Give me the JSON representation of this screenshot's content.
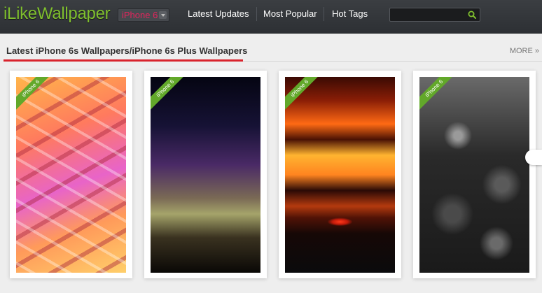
{
  "header": {
    "logo": "iLikeWallpaper",
    "device_select": "iPhone 6",
    "nav": [
      "Latest Updates",
      "Most Popular",
      "Hot Tags"
    ],
    "search": {
      "value": "",
      "placeholder": ""
    }
  },
  "section": {
    "title": "Latest iPhone 6s Wallpapers/iPhone 6s Plus Wallpapers",
    "more": "MORE »"
  },
  "wallpapers": [
    {
      "badge": "iPhone 6",
      "subject": "colorful ribbons"
    },
    {
      "badge": "iPhone 6",
      "subject": "purple green gradient"
    },
    {
      "badge": "iPhone 6",
      "subject": "red sunset"
    },
    {
      "badge": "iPhone 6",
      "subject": "black and white roses"
    }
  ],
  "colors": {
    "logo": "#7fbf2e",
    "device": "#e2255c",
    "accent_underline": "#d9232d",
    "badge": "#62a82a",
    "topbar": "#34373b"
  },
  "icons": {
    "search": "search-icon",
    "dropdown": "chevron-down-icon"
  }
}
